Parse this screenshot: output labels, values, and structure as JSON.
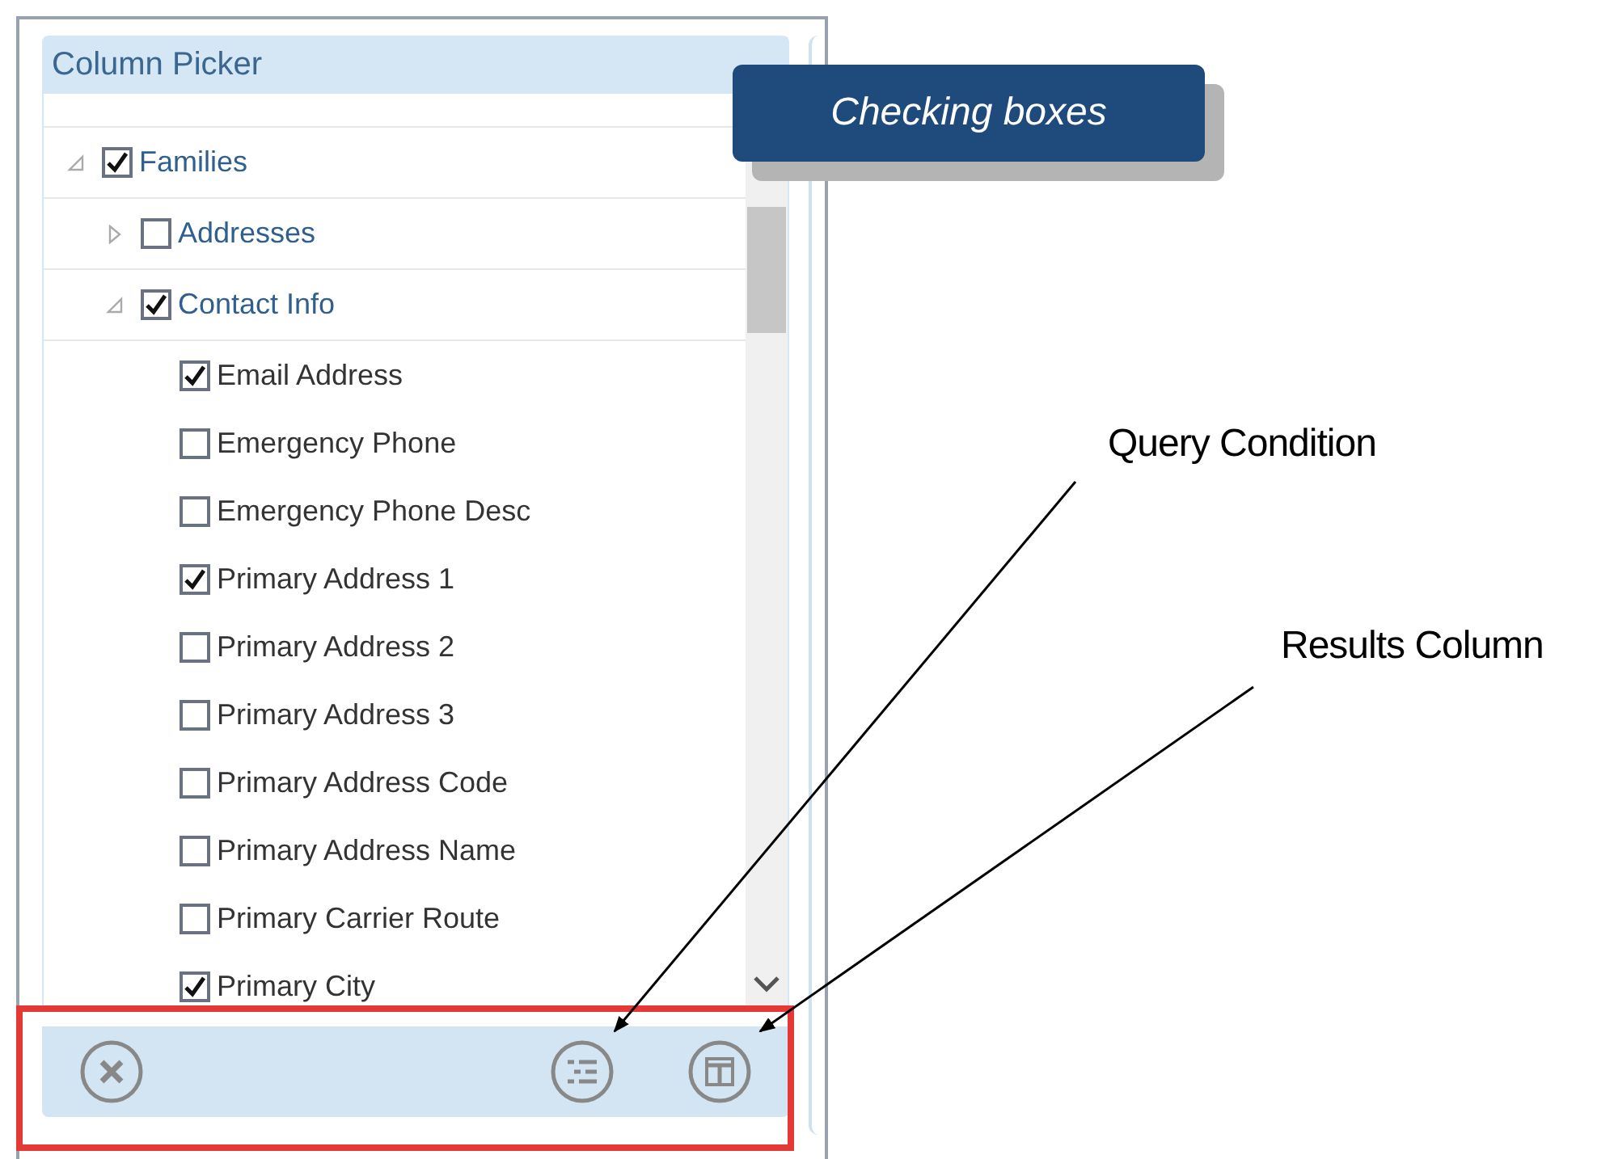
{
  "panel": {
    "title": "Column Picker",
    "tree": [
      {
        "label": "Families",
        "checked": true,
        "expanded": true,
        "children": [
          {
            "label": "Addresses",
            "checked": false,
            "expanded": false
          },
          {
            "label": "Contact Info",
            "checked": true,
            "expanded": true,
            "children": [
              {
                "label": "Email Address",
                "checked": true
              },
              {
                "label": "Emergency Phone",
                "checked": false
              },
              {
                "label": "Emergency Phone Desc",
                "checked": false
              },
              {
                "label": "Primary Address 1",
                "checked": true
              },
              {
                "label": "Primary Address 2",
                "checked": false
              },
              {
                "label": "Primary Address 3",
                "checked": false
              },
              {
                "label": "Primary Address Code",
                "checked": false
              },
              {
                "label": "Primary Address Name",
                "checked": false
              },
              {
                "label": "Primary Carrier Route",
                "checked": false
              },
              {
                "label": "Primary City",
                "checked": true
              }
            ]
          }
        ]
      }
    ],
    "footer_buttons": [
      {
        "kind": "clear"
      },
      {
        "kind": "query"
      },
      {
        "kind": "results"
      }
    ]
  },
  "callout": {
    "text": "Checking boxes"
  },
  "annotations": [
    {
      "text": "Query Condition"
    },
    {
      "text": "Results Column"
    }
  ]
}
